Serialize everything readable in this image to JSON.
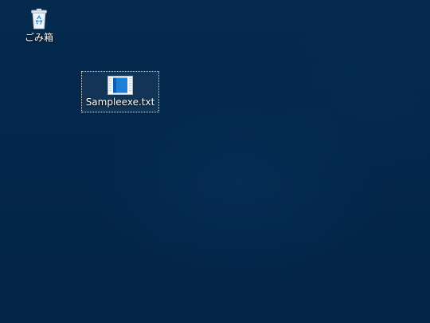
{
  "desktop": {
    "icons": [
      {
        "label": "ごみ箱",
        "icon": "recycle-bin-icon"
      },
      {
        "label": "Sampleexe.txt",
        "icon": "text-file-icon"
      }
    ]
  },
  "colors": {
    "background": "#03274a",
    "selection_border": "#ffffff",
    "file_icon_blue": "#1e7fd8"
  }
}
